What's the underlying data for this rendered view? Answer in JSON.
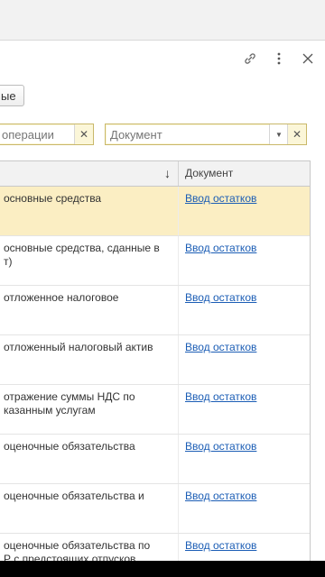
{
  "toolbar": {
    "link_icon": "link-icon",
    "more_icon": "more-vertical-icon",
    "close_icon": "close-icon"
  },
  "button_label": "ые",
  "filters": {
    "operation_placeholder": "операции",
    "document_placeholder": "Документ"
  },
  "table": {
    "columns": [
      "↓",
      "Документ"
    ],
    "rows": [
      {
        "operation": "основные средства",
        "document": "Ввод остатков",
        "selected": true
      },
      {
        "operation": "основные средства, сданные в\nт)",
        "document": "Ввод остатков"
      },
      {
        "operation": "отложенное налоговое",
        "document": "Ввод остатков"
      },
      {
        "operation": "отложенный налоговый актив",
        "document": "Ввод остатков"
      },
      {
        "operation": "отражение суммы НДС по\nказанным услугам",
        "document": "Ввод остатков"
      },
      {
        "operation": "оценочные обязательства",
        "document": "Ввод остатков"
      },
      {
        "operation": "оценочные обязательства и",
        "document": "Ввод остатков"
      },
      {
        "operation": "оценочные обязательства по\nР с предстоящих отпусков",
        "document": "Ввод остатков"
      }
    ]
  }
}
